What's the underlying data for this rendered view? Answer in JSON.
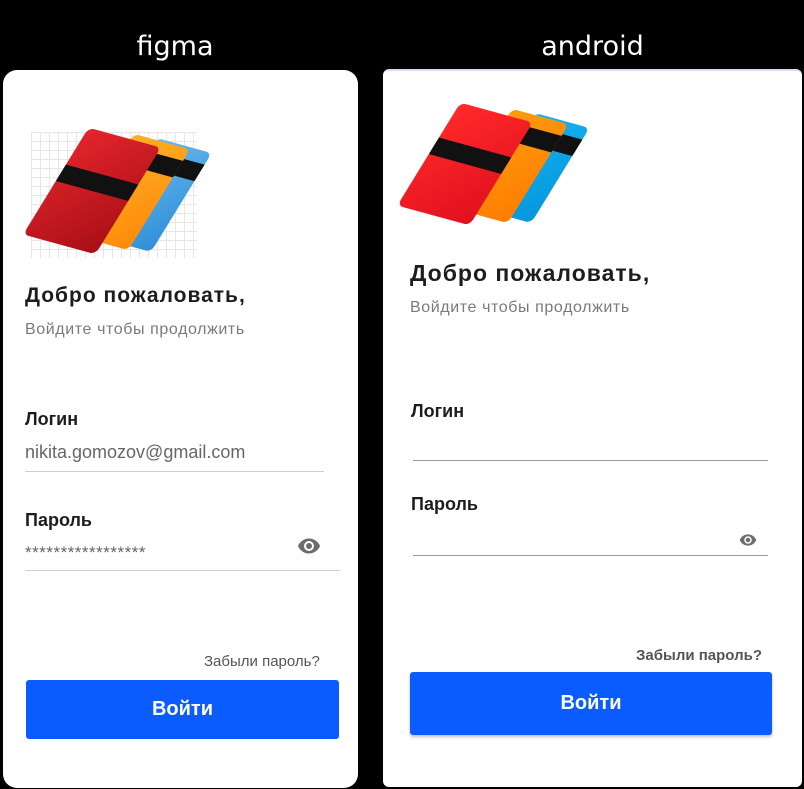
{
  "headers": {
    "left": "figma",
    "right": "android"
  },
  "figma": {
    "title": "Добро пожаловать,",
    "subtitle": "Войдите чтобы продолжить",
    "login_label": "Логин",
    "login_value": "nikita.gomozov@gmail.com",
    "password_label": "Пароль",
    "password_value": "*****************",
    "forgot_label": "Забыли пароль?",
    "submit_label": "Войти"
  },
  "android": {
    "title": "Добро пожаловать,",
    "subtitle": "Войдите чтобы продолжить",
    "login_label": "Логин",
    "login_value": "",
    "password_label": "Пароль",
    "password_value": "",
    "forgot_label": "Забыли пароль?",
    "submit_label": "Войти"
  },
  "colors": {
    "accent": "#0a5cff",
    "card_red": "#d41a24",
    "card_orange": "#ff9a12",
    "card_blue": "#3aa6e6"
  },
  "icons": {
    "password_toggle": "eye-icon",
    "logo": "credit-cards-logo"
  }
}
